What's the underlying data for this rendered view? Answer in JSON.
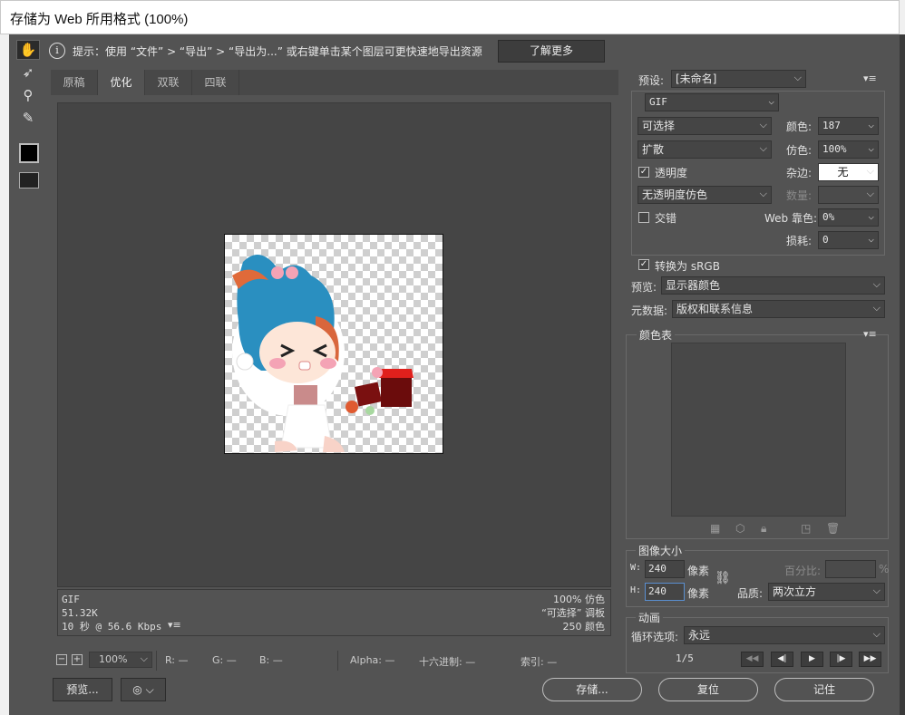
{
  "window": {
    "title": "存储为 Web 所用格式 (100%)"
  },
  "tools": {
    "hand": "hand-icon",
    "slice": "slice-select-icon",
    "zoom": "zoom-icon",
    "eyedropper": "eyedropper-icon"
  },
  "hint": {
    "text": "提示：使用 “文件” > “导出” > “导出为...” 或右键单击某个图层可更快速地导出资源",
    "learn_more": "了解更多"
  },
  "tabs": [
    "原稿",
    "优化",
    "双联",
    "四联"
  ],
  "active_tab": "优化",
  "image_info": {
    "format": "GIF",
    "size": "51.32K",
    "time": "10 秒 @ 56.6 Kbps",
    "dither": "100% 仿色",
    "palette": "“可选择” 调板",
    "colors": "250 颜色"
  },
  "status": {
    "zoom": "100%",
    "r": "R: —",
    "g": "G: —",
    "b": "B: —",
    "alpha": "Alpha: —",
    "hex": "十六进制: —",
    "index": "索引: —"
  },
  "buttons": {
    "preview": "预览...",
    "save": "存储...",
    "reset": "复位",
    "remember": "记住"
  },
  "settings": {
    "preset_label": "预设:",
    "preset_value": "[未命名]",
    "format": "GIF",
    "reduction": "可选择",
    "dither_algo": "扩散",
    "colors_label": "颜色:",
    "colors_value": "187",
    "dither_label": "仿色:",
    "dither_value": "100%",
    "transparency_label": "透明度",
    "transparency_checked": true,
    "matte_label": "杂边:",
    "matte_value": "无",
    "trans_dither": "无透明度仿色",
    "amount_label": "数量:",
    "interlaced_label": "交错",
    "interlaced_checked": false,
    "websnap_label": "Web 靠色:",
    "websnap_value": "0%",
    "lossy_label": "损耗:",
    "lossy_value": "0",
    "srgb_label": "转换为 sRGB",
    "srgb_checked": true,
    "preview_label": "预览:",
    "preview_value": "显示器颜色",
    "metadata_label": "元数据:",
    "metadata_value": "版权和联系信息"
  },
  "color_table": {
    "title": "颜色表"
  },
  "image_size": {
    "title": "图像大小",
    "w_label": "W:",
    "w_value": "240",
    "h_label": "H:",
    "h_value": "240",
    "unit": "像素",
    "percent_label": "百分比:",
    "percent_unit": "%",
    "quality_label": "品质:",
    "quality_value": "两次立方"
  },
  "animation": {
    "title": "动画",
    "loop_label": "循环选项:",
    "loop_value": "永远",
    "frame": "1/5"
  }
}
